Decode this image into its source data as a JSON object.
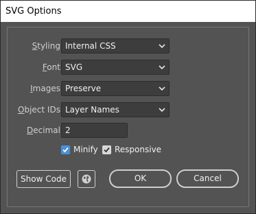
{
  "window": {
    "title": "SVG Options"
  },
  "form": {
    "styling": {
      "label_prefix": "",
      "label_key": "S",
      "label_rest": "tyling:",
      "value": "Internal CSS"
    },
    "font": {
      "label_prefix": "",
      "label_key": "F",
      "label_rest": "ont:",
      "value": "SVG"
    },
    "images": {
      "label_prefix": "",
      "label_key": "I",
      "label_rest": "mages:",
      "value": "Preserve"
    },
    "object_ids": {
      "label_prefix": "",
      "label_key": "O",
      "label_rest": "bject IDs:",
      "value": "Layer Names"
    },
    "decimal": {
      "label_prefix": "",
      "label_key": "D",
      "label_rest": "ecimal:",
      "value": "2"
    }
  },
  "options": {
    "minify": {
      "label": "Minify",
      "checked": true
    },
    "responsive": {
      "label": "Responsive",
      "checked": true
    }
  },
  "buttons": {
    "show_code": "Show Code",
    "ok": "OK",
    "cancel": "Cancel"
  },
  "icons": {
    "dropdown": "chevron-down-icon",
    "web": "globe-icon",
    "check": "checkmark-icon"
  },
  "colors": {
    "background": "#535353",
    "field": "#3d3d3d",
    "accent_check": "#4a90d9"
  }
}
